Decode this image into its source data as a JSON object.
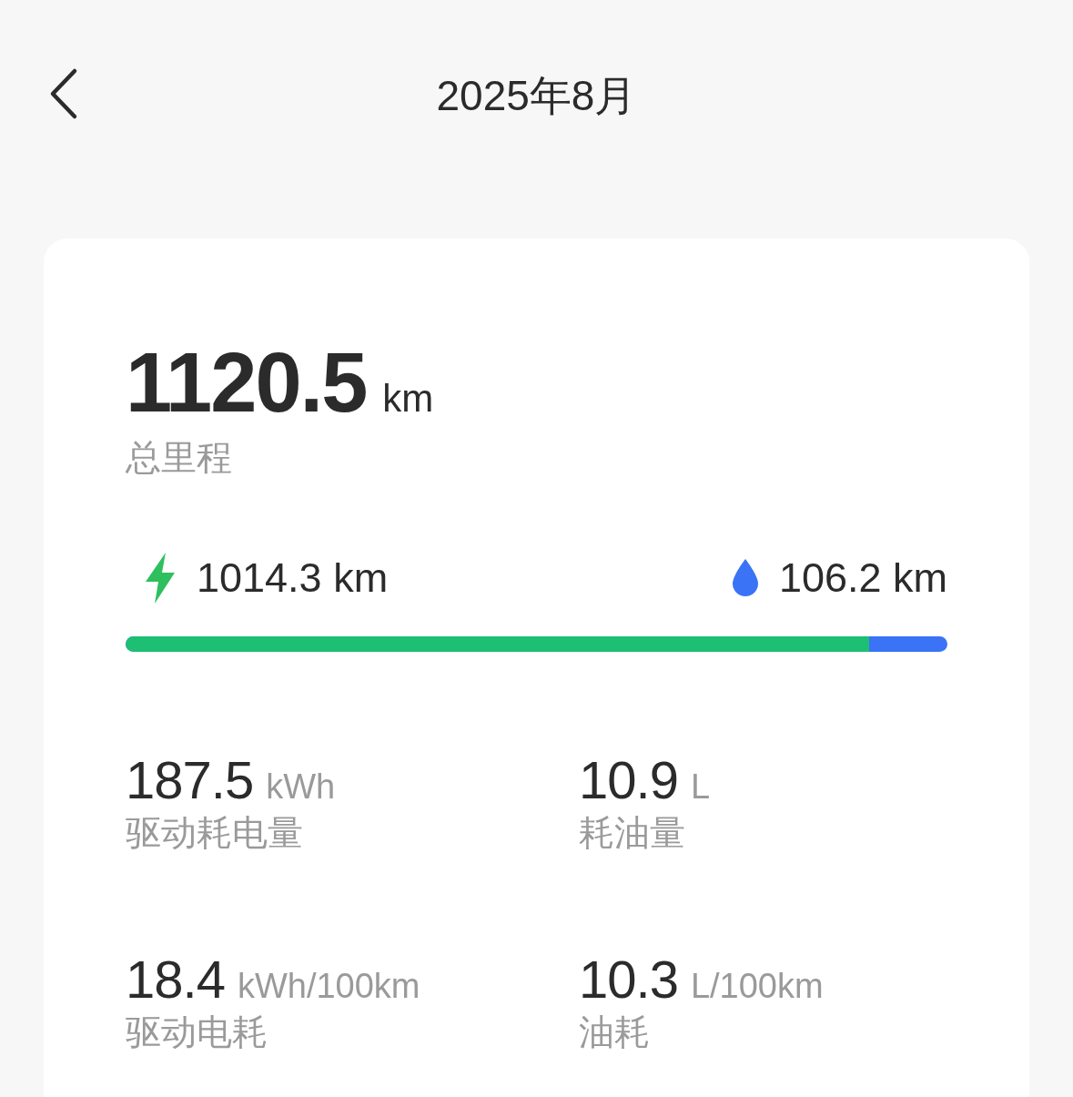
{
  "header": {
    "title": "2025年8月"
  },
  "summary": {
    "total": {
      "value": "1120.5",
      "unit": "km",
      "label": "总里程"
    },
    "electric": {
      "value": "1014.3",
      "unit": "km"
    },
    "fuel": {
      "value": "106.2",
      "unit": "km"
    },
    "level": 0.905
  },
  "stats": [
    {
      "value": "187.5",
      "unit": "kWh",
      "label": "驱动耗电量"
    },
    {
      "value": "10.9",
      "unit": "L",
      "label": "耗油量"
    },
    {
      "value": "18.4",
      "unit": "kWh/100km",
      "label": "驱动电耗"
    },
    {
      "value": "10.3",
      "unit": "L/100km",
      "label": "油耗"
    }
  ]
}
